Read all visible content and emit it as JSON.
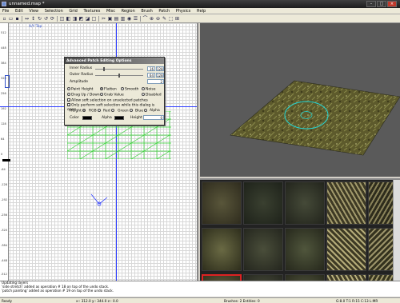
{
  "window": {
    "title": "unnamed.map *"
  },
  "menu": [
    "File",
    "Edit",
    "View",
    "Selection",
    "Grid",
    "Textures",
    "Misc",
    "Region",
    "Brush",
    "Patch",
    "Physics",
    "Help"
  ],
  "view2d": {
    "label": "X/Y Top",
    "axis_labels": [
      "512",
      "448",
      "384",
      "320",
      "256",
      "192",
      "128",
      "64",
      "0",
      "-64",
      "-128",
      "-192",
      "-256",
      "-320",
      "-384",
      "-448",
      "-512"
    ]
  },
  "dialog": {
    "title": "Advanced Patch Editing Options",
    "inner_radius_label": "Inner Radius",
    "inner_radius_value": "16",
    "inner_radius_max": "128",
    "inner_radius_fraction": 0.17,
    "outer_radius_label": "Outer Radius",
    "outer_radius_value": "64",
    "outer_radius_max": "128",
    "outer_radius_fraction": 0.5,
    "amplitude_label": "Amplitude",
    "amplitude_value": "2",
    "opt_paint_height": "Paint Height",
    "opt_flatten": "Flatten",
    "opt_smooth": "Smooth",
    "opt_noise": "Noise",
    "opt_drag": "Drag Up / Down",
    "opt_grab": "Grab Value",
    "opt_disabled": "Disabled",
    "check_soft_unselected": "Allow soft selection on unselected patches",
    "check_soft_open": "Only perform soft selection while this dialog is open",
    "rgb_height": "Height",
    "rgb_rgb": "RGB",
    "rgb_red": "Red",
    "rgb_green": "Green",
    "rgb_blue": "Blue",
    "rgb_alpha": "Alpha",
    "color_label": "Color",
    "alpha_label": "Alpha",
    "height_label": "Height",
    "height_value": "0"
  },
  "console": {
    "lines": [
      "Updating layers",
      "'side stretch' added as operation # 18 on top of the undo stack.",
      "'patch painting' added as operation # 19 on top of the undo stack."
    ]
  },
  "coords": "x:: 312.0  y:: 344.0  z:: 0.0",
  "status": {
    "left": "Ready",
    "middle": "Brushes: 2  Entities: 0",
    "right": "G:8.0  T:1  R:15  C:13  L:MR"
  },
  "colors": {
    "blue_axis": "#2b3bff",
    "patch_green": "#35d435",
    "selection_red": "#dd2222"
  }
}
